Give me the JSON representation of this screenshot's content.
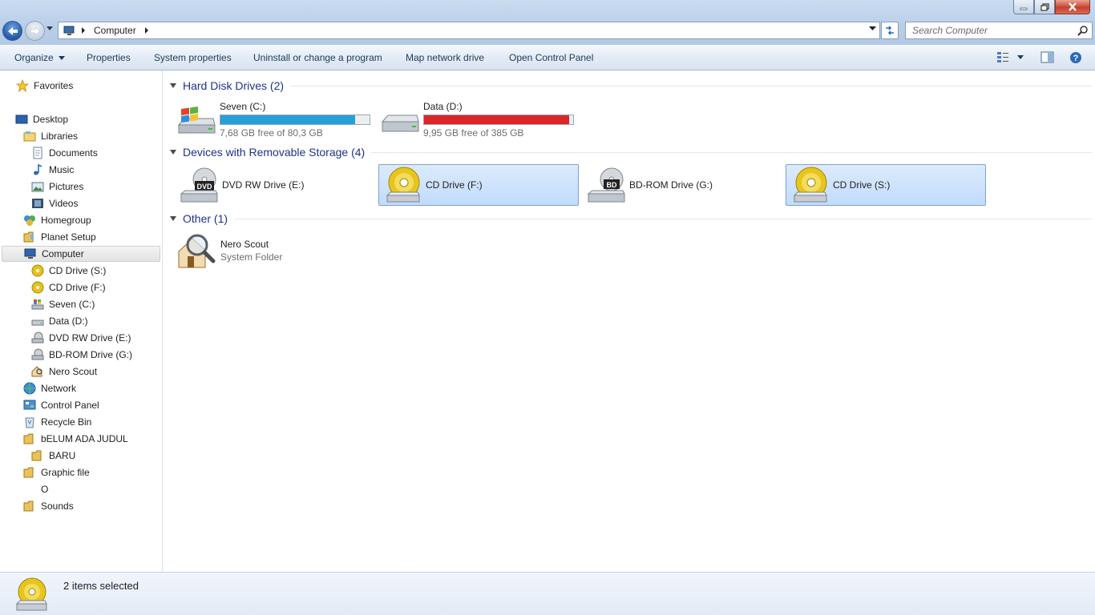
{
  "window": {
    "controls": {
      "minimize": "minimize",
      "maximize": "restore",
      "close": "close"
    }
  },
  "address": {
    "path": "Computer",
    "search_placeholder": "Search Computer"
  },
  "toolbar": {
    "organize": "Organize",
    "properties": "Properties",
    "system_properties": "System properties",
    "uninstall": "Uninstall or change a program",
    "map_drive": "Map network drive",
    "control_panel": "Open Control Panel"
  },
  "sidebar": {
    "items": [
      {
        "label": "Favorites",
        "icon": "star-icon"
      },
      {
        "label": "Desktop",
        "icon": "desktop-icon"
      },
      {
        "label": "Libraries",
        "icon": "libraries-icon"
      },
      {
        "label": "Documents",
        "icon": "documents-icon"
      },
      {
        "label": "Music",
        "icon": "music-icon"
      },
      {
        "label": "Pictures",
        "icon": "pictures-icon"
      },
      {
        "label": "Videos",
        "icon": "videos-icon"
      },
      {
        "label": "Homegroup",
        "icon": "homegroup-icon"
      },
      {
        "label": "Planet Setup",
        "icon": "folder-icon"
      },
      {
        "label": "Computer",
        "icon": "computer-icon",
        "selected": true
      },
      {
        "label": "CD Drive (S:)",
        "icon": "cd-drive-icon"
      },
      {
        "label": "CD Drive (F:)",
        "icon": "cd-drive-icon"
      },
      {
        "label": "Seven (C:)",
        "icon": "windows-drive-icon"
      },
      {
        "label": "Data (D:)",
        "icon": "hard-drive-icon"
      },
      {
        "label": "DVD RW Drive (E:)",
        "icon": "dvd-drive-icon"
      },
      {
        "label": "BD-ROM Drive (G:)",
        "icon": "bd-drive-icon"
      },
      {
        "label": "Nero Scout",
        "icon": "nero-scout-icon"
      },
      {
        "label": "Network",
        "icon": "network-icon"
      },
      {
        "label": "Control Panel",
        "icon": "control-panel-icon"
      },
      {
        "label": "Recycle Bin",
        "icon": "recycle-bin-icon"
      },
      {
        "label": "bELUM ADA JUDUL",
        "icon": "folder-icon"
      },
      {
        "label": "BARU",
        "icon": "folder-icon"
      },
      {
        "label": "Graphic file",
        "icon": "folder-icon"
      },
      {
        "label": "O",
        "icon": "blank-icon"
      },
      {
        "label": "Sounds",
        "icon": "folder-icon"
      }
    ]
  },
  "groups": {
    "hdd": {
      "title": "Hard Disk Drives (2)"
    },
    "removable": {
      "title": "Devices with Removable Storage (4)"
    },
    "other": {
      "title": "Other (1)"
    }
  },
  "drives": [
    {
      "name": "Seven (C:)",
      "free": "7,68 GB free of 80,3 GB",
      "used_fraction": 0.904,
      "bar_color": "#26a0da",
      "icon": "windows-drive-icon"
    },
    {
      "name": "Data (D:)",
      "free": "9,95 GB free of 385 GB",
      "used_fraction": 0.974,
      "bar_color": "#da2626",
      "icon": "hard-drive-icon"
    }
  ],
  "devices": [
    {
      "name": "DVD RW Drive (E:)",
      "icon": "dvd-drive-icon",
      "selected": false
    },
    {
      "name": "CD Drive (F:)",
      "icon": "cd-drive-icon",
      "selected": true
    },
    {
      "name": "BD-ROM Drive (G:)",
      "icon": "bd-drive-icon",
      "selected": false
    },
    {
      "name": "CD Drive (S:)",
      "icon": "cd-drive-icon",
      "selected": true
    }
  ],
  "other_items": [
    {
      "name": "Nero Scout",
      "type": "System Folder",
      "icon": "nero-scout-icon"
    }
  ],
  "status": {
    "selection": "2 items selected"
  }
}
